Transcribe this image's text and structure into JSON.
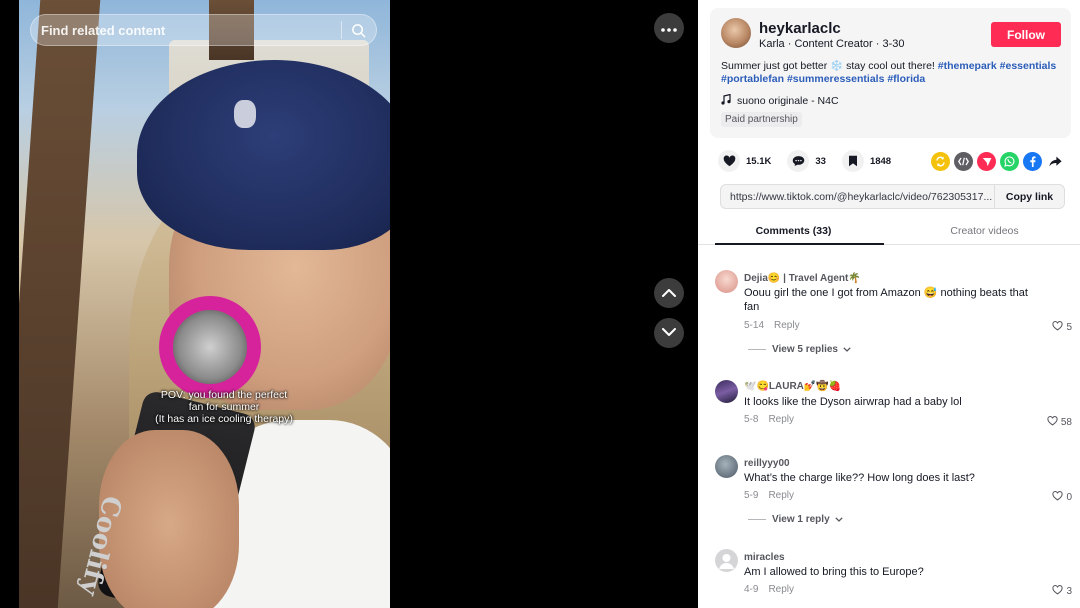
{
  "search": {
    "placeholder": "Find related content"
  },
  "video": {
    "caption_lines": [
      "POV: you found the perfect",
      "fan for summer",
      "(It has an ice cooling therapy)"
    ],
    "fan_brand": "Coolify"
  },
  "post": {
    "username": "heykarlaclc",
    "subline": "Karla · Content Creator · 3-30",
    "follow_label": "Follow",
    "description_text": "Summer just got better ❄️ stay cool out there!",
    "hashtags": [
      "#themepark",
      "#essentials",
      "#portablefan",
      "#summeressentials",
      "#florida"
    ],
    "music": "suono originale - N4C",
    "partnership": "Paid partnership"
  },
  "actions": {
    "likes": "15.1K",
    "comments": "33",
    "saves": "1848"
  },
  "share": {
    "icons": [
      "repost-icon",
      "embed-icon",
      "send-icon",
      "whatsapp-icon",
      "facebook-icon",
      "share-arrow-icon"
    ],
    "colors": [
      "#f4c20d",
      "#5e5e63",
      "#fe2c55",
      "#25d366",
      "#1877f2",
      "#161823"
    ]
  },
  "link": {
    "url": "https://www.tiktok.com/@heykarlaclc/video/762305317...",
    "copy_label": "Copy link"
  },
  "tabs": [
    {
      "label": "Comments (33)",
      "active": true
    },
    {
      "label": "Creator videos",
      "active": false
    }
  ],
  "comments": [
    {
      "name": "Dejia😊 | Travel Agent🌴",
      "text": "Oouu girl the one I got from Amazon 😅 nothing beats that fan",
      "date": "5-14",
      "reply_label": "Reply",
      "likes": "5",
      "replies": "View 5 replies",
      "avatar_color": "#e9b8b0"
    },
    {
      "name": "🕊️😋LAURA💅🤠🍓",
      "text": "It looks like the Dyson airwrap had a baby lol",
      "date": "5-8",
      "reply_label": "Reply",
      "likes": "58",
      "replies": "",
      "avatar_color": "#5b3b6e"
    },
    {
      "name": "reillyyy00",
      "text": "What’s the charge like?? How long does it last?",
      "date": "5-9",
      "reply_label": "Reply",
      "likes": "0",
      "replies": "View 1 reply",
      "avatar_color": "#6f7e8a"
    },
    {
      "name": "miracles",
      "text": "Am I allowed to bring this to Europe?",
      "date": "4-9",
      "reply_label": "Reply",
      "likes": "3",
      "replies": "",
      "avatar_color": "#c9c9cc"
    }
  ]
}
